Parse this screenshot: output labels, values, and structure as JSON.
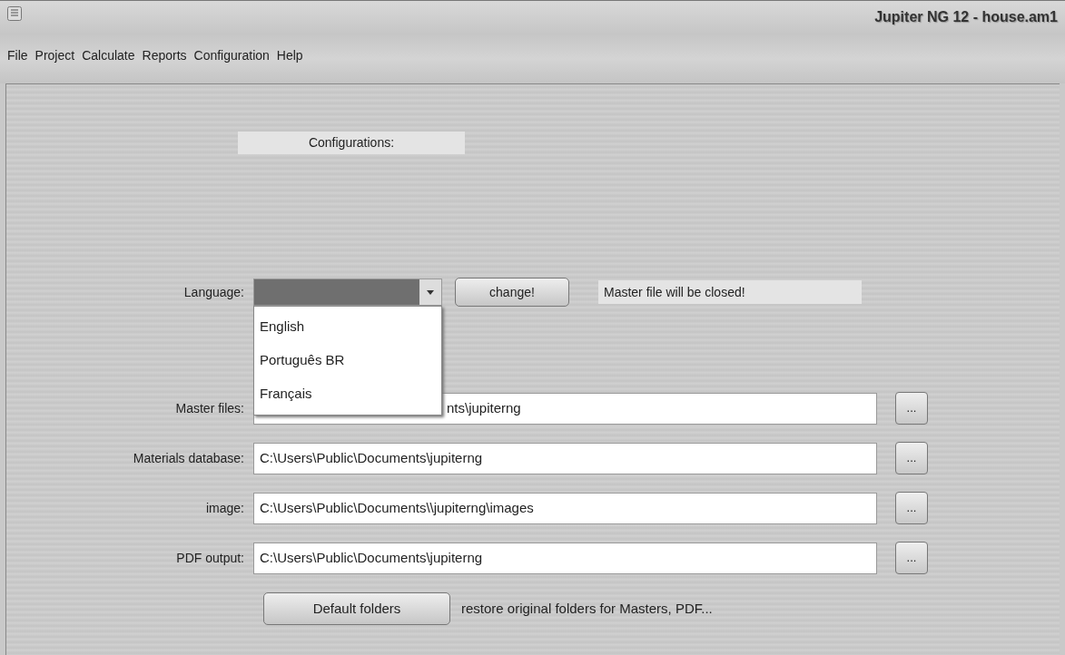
{
  "window": {
    "title": "Jupiter NG 12 - house.am1"
  },
  "menu": [
    "File",
    "Project",
    "Calculate",
    "Reports",
    "Configuration",
    "Help"
  ],
  "section_title": "Configurations:",
  "language": {
    "label": "Language:",
    "button": "change!",
    "warning": "Master file will be closed!",
    "dropdown_open": true,
    "options": [
      {
        "label": "English",
        "selected": false
      },
      {
        "label": "Português BR",
        "selected": false
      },
      {
        "label": "Français",
        "selected": false
      }
    ]
  },
  "folders": [
    {
      "label": "Master files:",
      "value": "nts\\jupiterng",
      "button": "..."
    },
    {
      "label": "Materials database:",
      "value": "C:\\Users\\Public\\Documents\\jupiterng",
      "button": "..."
    },
    {
      "label": "image:",
      "value": "C:\\Users\\Public\\Documents\\\\jupiterng\\images",
      "button": "..."
    },
    {
      "label": "PDF output:",
      "value": "C:\\Users\\Public\\Documents\\jupiterng",
      "button": "..."
    }
  ],
  "default_button": "Default folders",
  "default_note": "restore original folders for Masters, PDF..."
}
